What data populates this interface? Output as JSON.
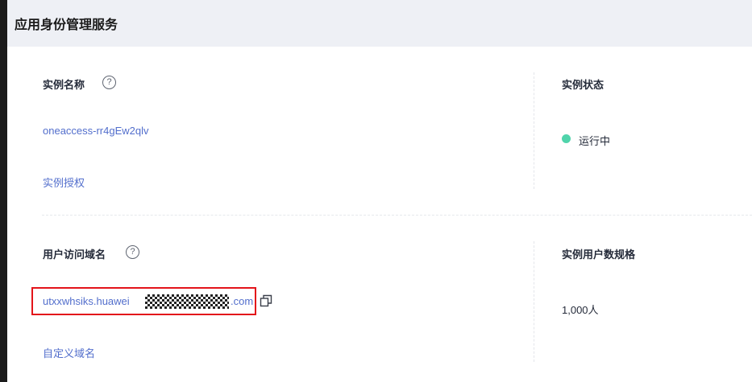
{
  "header": {
    "title": "应用身份管理服务"
  },
  "instance": {
    "name_label": "实例名称",
    "name_value": "oneaccess-rr4gEw2qlv",
    "authorize_link": "实例授权",
    "status_label": "实例状态",
    "status_value": "运行中",
    "status_color": "#50d4ab"
  },
  "domain": {
    "label": "用户访问域名",
    "url_prefix": "utxxwhsiks.huawei",
    "url_suffix": ".com",
    "custom_domain_link": "自定义域名"
  },
  "spec": {
    "label": "实例用户数规格",
    "value": "1,000人"
  },
  "icons": {
    "help": "help-circle-icon",
    "copy": "copy-icon"
  },
  "colors": {
    "link": "#526ecc",
    "highlight": "#e3141a",
    "header_bg": "#eef0f5"
  }
}
